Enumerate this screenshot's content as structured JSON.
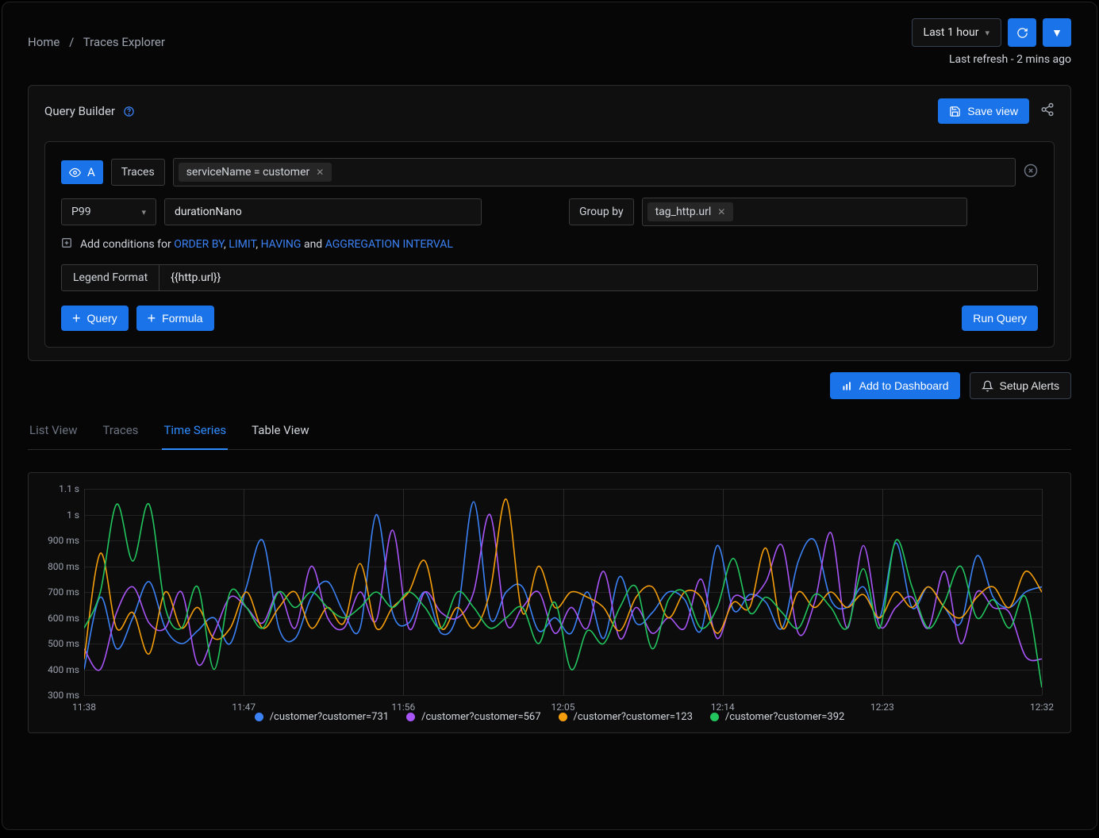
{
  "breadcrumb": {
    "home": "Home",
    "current": "Traces Explorer"
  },
  "top": {
    "time_range": "Last 1 hour",
    "last_refresh": "Last refresh - 2 mins ago"
  },
  "query_builder": {
    "title": "Query Builder",
    "save_view": "Save view"
  },
  "query": {
    "id": "A",
    "source": "Traces",
    "filter_tag": "serviceName = customer",
    "aggregator": "P99",
    "metric": "durationNano",
    "group_by_label": "Group by",
    "group_by_tag": "tag_http.url",
    "conditions_prefix": "Add conditions for",
    "order_by": "ORDER BY",
    "limit": "LIMIT",
    "having": "HAVING",
    "and": "and",
    "agg_interval": "AGGREGATION INTERVAL",
    "legend_label": "Legend Format",
    "legend_value": "{{http.url}}",
    "add_query": "Query",
    "add_formula": "Formula",
    "run_query": "Run Query"
  },
  "dash": {
    "add_dashboard": "Add to Dashboard",
    "setup_alerts": "Setup Alerts"
  },
  "tabs": {
    "list_view": "List View",
    "traces": "Traces",
    "time_series": "Time Series",
    "table_view": "Table View"
  },
  "chart_data": {
    "type": "line",
    "ylabel": "",
    "xlabel": "",
    "ylim": [
      300,
      1100
    ],
    "y_ticks": [
      "1.1 s",
      "1 s",
      "900 ms",
      "800 ms",
      "700 ms",
      "600 ms",
      "500 ms",
      "400 ms",
      "300 ms"
    ],
    "x_ticks": [
      "11:38",
      "11:47",
      "11:56",
      "12:05",
      "12:14",
      "12:23",
      "12:32"
    ],
    "x": [
      0,
      1,
      2,
      3,
      4,
      5,
      6,
      7,
      8,
      9,
      10,
      11,
      12,
      13,
      14,
      15,
      16,
      17,
      18,
      19,
      20,
      21,
      22,
      23,
      24,
      25,
      26,
      27,
      28,
      29,
      30,
      31,
      32,
      33,
      34,
      35,
      36,
      37,
      38,
      39,
      40,
      41,
      42,
      43,
      44,
      45,
      46,
      47,
      48,
      49,
      50,
      51,
      52,
      53,
      54,
      55,
      56,
      57,
      58,
      59
    ],
    "series": [
      {
        "name": "/customer?customer=731",
        "color": "#3b82f6",
        "values": [
          400,
          680,
          480,
          600,
          740,
          560,
          500,
          550,
          600,
          500,
          720,
          900,
          560,
          520,
          680,
          740,
          620,
          560,
          1000,
          620,
          580,
          700,
          540,
          620,
          1050,
          600,
          700,
          720,
          550,
          600,
          540,
          700,
          520,
          760,
          580,
          620,
          700,
          670,
          550,
          880,
          630,
          690,
          660,
          560,
          820,
          900,
          670,
          640,
          720,
          600,
          890,
          640,
          720,
          640,
          580,
          840,
          680,
          640,
          700,
          720
        ]
      },
      {
        "name": "/customer?customer=567",
        "color": "#a855f7",
        "values": [
          480,
          400,
          620,
          720,
          580,
          560,
          700,
          420,
          540,
          680,
          640,
          580,
          700,
          560,
          800,
          600,
          560,
          700,
          590,
          940,
          560,
          700,
          620,
          600,
          700,
          1000,
          580,
          640,
          700,
          540,
          640,
          560,
          780,
          520,
          640,
          540,
          600,
          560,
          750,
          520,
          680,
          670,
          740,
          880,
          540,
          660,
          930,
          560,
          880,
          570,
          640,
          680,
          560,
          780,
          500,
          700,
          640,
          620,
          450,
          440
        ]
      },
      {
        "name": "/customer?customer=123",
        "color": "#f59e0b",
        "values": [
          440,
          850,
          560,
          620,
          460,
          700,
          560,
          640,
          520,
          560,
          700,
          560,
          640,
          700,
          560,
          640,
          580,
          810,
          560,
          640,
          700,
          820,
          560,
          640,
          560,
          700,
          1060,
          620,
          800,
          640,
          700,
          680,
          640,
          550,
          680,
          720,
          600,
          700,
          680,
          540,
          660,
          640,
          870,
          560,
          700,
          640,
          700,
          640,
          690,
          600,
          700,
          640,
          720,
          640,
          600,
          680,
          720,
          640,
          780,
          700
        ]
      },
      {
        "name": "/customer?customer=392",
        "color": "#22c55e",
        "values": [
          560,
          700,
          1040,
          820,
          1040,
          640,
          560,
          720,
          400,
          700,
          640,
          560,
          700,
          640,
          700,
          640,
          600,
          640,
          700,
          640,
          700,
          640,
          560,
          700,
          640,
          560,
          600,
          640,
          500,
          660,
          400,
          550,
          500,
          640,
          720,
          480,
          670,
          700,
          560,
          640,
          830,
          620,
          680,
          620,
          560,
          690,
          640,
          560,
          790,
          560,
          900,
          720,
          560,
          660,
          800,
          600,
          670,
          560,
          680,
          330
        ]
      }
    ]
  },
  "icons": {
    "refresh": "refresh-icon",
    "caret": "caret-down-icon"
  }
}
